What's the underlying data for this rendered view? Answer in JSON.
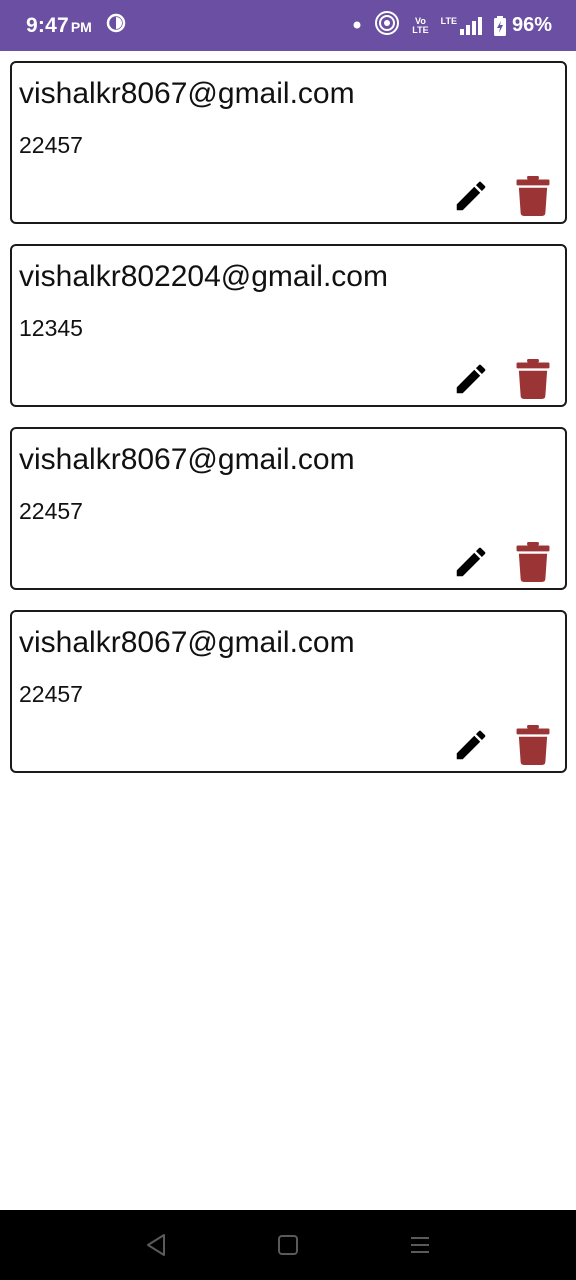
{
  "status_bar": {
    "time": "9:47",
    "ampm": "PM",
    "network_small_top": "Vo",
    "network_small_bottom": "LTE",
    "lte_label": "LTE",
    "battery_percent": "96%",
    "background_color": "#6a4fa3"
  },
  "cards": [
    {
      "email": "vishalkr8067@gmail.com",
      "code": "22457"
    },
    {
      "email": "vishalkr802204@gmail.com",
      "code": "12345"
    },
    {
      "email": "vishalkr8067@gmail.com",
      "code": "22457"
    },
    {
      "email": "vishalkr8067@gmail.com",
      "code": "22457"
    }
  ],
  "icons": {
    "edit": "pencil-icon",
    "delete": "trash-icon",
    "delete_color": "#9b3535"
  },
  "nav_bar": {
    "back": "back-triangle-icon",
    "home": "home-square-icon",
    "menu": "menu-lines-icon"
  }
}
